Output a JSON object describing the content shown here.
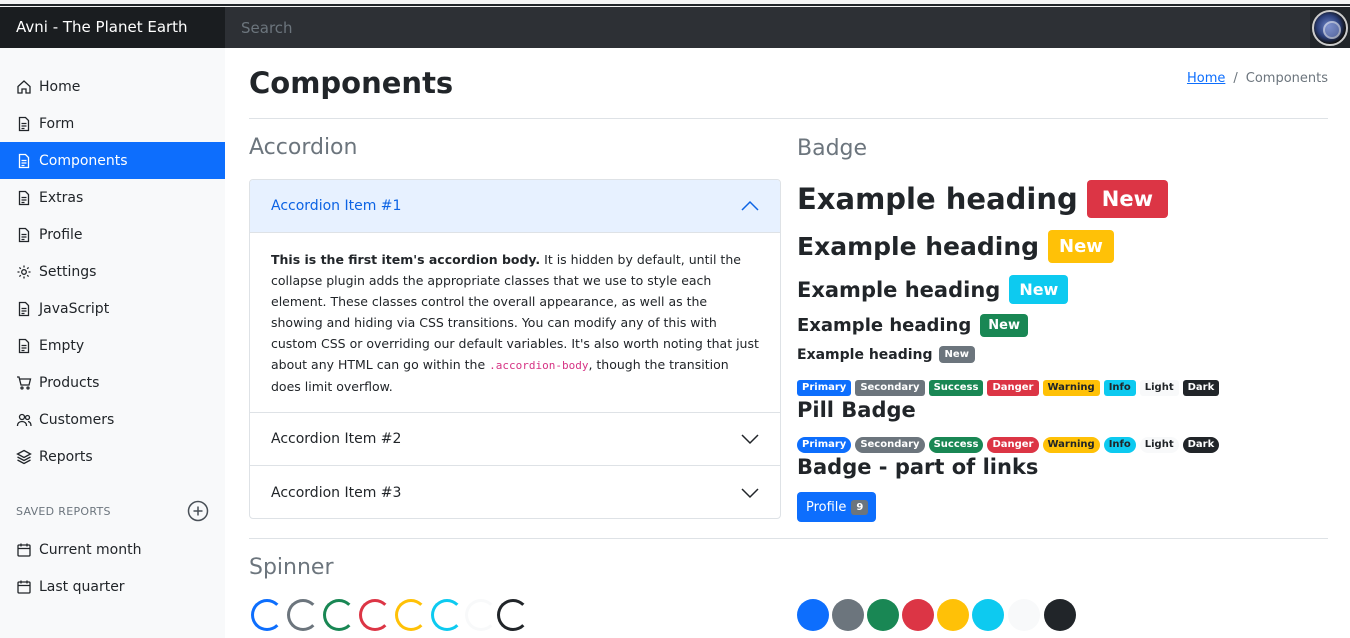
{
  "app": {
    "title": "Avni - The Planet Earth"
  },
  "search": {
    "placeholder": "Search"
  },
  "sidebar": {
    "items": [
      {
        "label": "Home",
        "icon": "home-icon"
      },
      {
        "label": "Form",
        "icon": "document-icon"
      },
      {
        "label": "Components",
        "icon": "document-icon",
        "active": true
      },
      {
        "label": "Extras",
        "icon": "document-icon"
      },
      {
        "label": "Profile",
        "icon": "document-icon"
      },
      {
        "label": "Settings",
        "icon": "gear-icon"
      },
      {
        "label": "JavaScript",
        "icon": "document-icon"
      },
      {
        "label": "Empty",
        "icon": "document-icon"
      },
      {
        "label": "Products",
        "icon": "cart-icon"
      },
      {
        "label": "Customers",
        "icon": "users-icon"
      },
      {
        "label": "Reports",
        "icon": "layers-icon"
      }
    ],
    "saved_reports_title": "SAVED REPORTS",
    "saved_reports": [
      {
        "label": "Current month",
        "icon": "calendar-icon"
      },
      {
        "label": "Last quarter",
        "icon": "calendar-icon"
      }
    ]
  },
  "page": {
    "title": "Components",
    "breadcrumb": {
      "home": "Home",
      "separator": "/",
      "current": "Components"
    }
  },
  "accordion": {
    "title": "Accordion",
    "items": [
      {
        "label": "Accordion Item #1",
        "open": true
      },
      {
        "label": "Accordion Item #2",
        "open": false
      },
      {
        "label": "Accordion Item #3",
        "open": false
      }
    ],
    "body_bold": "This is the first item's accordion body.",
    "body_text1": " It is hidden by default, until the collapse plugin adds the appropriate classes that we use to style each element. These classes control the overall appearance, as well as the showing and hiding via CSS transitions. You can modify any of this with custom CSS or overriding our default variables. It's also worth noting that just about any HTML can go within the ",
    "body_code": ".accordion-body",
    "body_text2": ", though the transition does limit overflow."
  },
  "badge": {
    "title": "Badge",
    "heading_text": "Example heading",
    "new_label": "New",
    "variants": [
      "Primary",
      "Secondary",
      "Success",
      "Danger",
      "Warning",
      "Info",
      "Light",
      "Dark"
    ],
    "pill_title": "Pill Badge",
    "links_title": "Badge - part of links",
    "profile_button": "Profile",
    "profile_count": "9"
  },
  "spinner": {
    "title": "Spinner"
  },
  "colors": {
    "primary": "#0d6efd",
    "secondary": "#6c757d",
    "success": "#198754",
    "danger": "#dc3545",
    "warning": "#ffc107",
    "info": "#0dcaf0",
    "light": "#f8f9fa",
    "dark": "#212529"
  }
}
